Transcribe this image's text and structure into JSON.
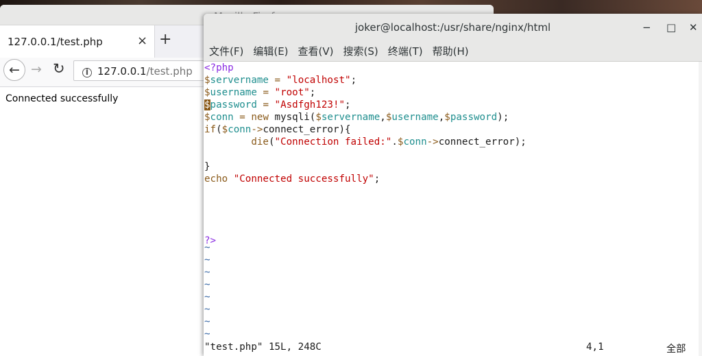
{
  "firefox": {
    "window_title": "Mozilla Firefox",
    "tab_title": "127.0.0.1/test.php",
    "tab_close": "×",
    "new_tab": "+",
    "url_host": "127.0.0.1",
    "url_path": "/test.php",
    "page_text": "Connected successfully"
  },
  "terminal": {
    "title": "joker@localhost:/usr/share/nginx/html",
    "minimize": "−",
    "maximize": "□",
    "close": "✕",
    "menu": [
      "文件(F)",
      "编辑(E)",
      "查看(V)",
      "搜索(S)",
      "终端(T)",
      "帮助(H)"
    ],
    "status_file": "\"test.php\" 15L, 248C",
    "status_pos": "4,1",
    "status_all": "全部"
  },
  "code_lines": [
    "<?php",
    "$servername = \"localhost\";",
    "$username = \"root\";",
    "$password = \"Asdfgh123!\";",
    "$conn = new mysqli($servername,$username,$password);",
    "if($conn->connect_error){",
    "        die(\"Connection failed:\".$conn->connect_error);",
    "",
    "}",
    "echo \"Connected successfully\";",
    "",
    "",
    "",
    "",
    "?>"
  ],
  "tilde": "~",
  "colors": {
    "keyword": "#8a5a1a",
    "variable": "#1e8e8e",
    "string": "#c00000",
    "php_tag": "#8a2be2",
    "tilde": "#3465a4"
  }
}
